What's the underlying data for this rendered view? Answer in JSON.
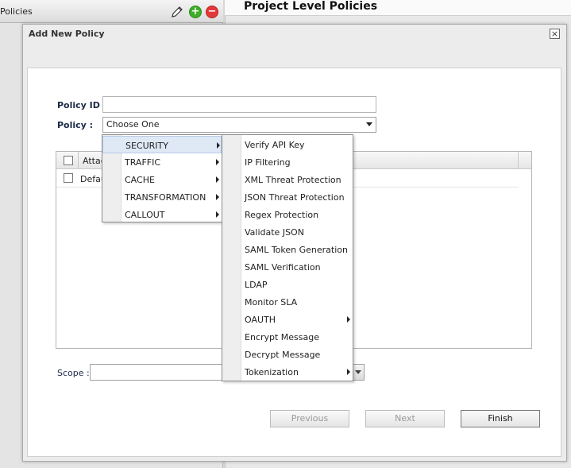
{
  "background": {
    "left_panel_title": "Policies",
    "right_panel_title": "Project Level Policies"
  },
  "dialog": {
    "title": "Add New Policy",
    "close_glyph": "×",
    "policy_id_label": "Policy ID :",
    "policy_id_value": "",
    "policy_label": "Policy :",
    "policy_selected": "Choose One",
    "grid_header": "Attac",
    "grid_rows": [
      "Defau"
    ],
    "scope_label": "Scope :",
    "scope_value": "",
    "buttons": {
      "previous": "Previous",
      "next": "Next",
      "finish": "Finish"
    }
  },
  "category_menu": [
    {
      "label": "SECURITY",
      "has_submenu": true,
      "active": true
    },
    {
      "label": "TRAFFIC",
      "has_submenu": true
    },
    {
      "label": "CACHE",
      "has_submenu": true
    },
    {
      "label": "TRANSFORMATION",
      "has_submenu": true
    },
    {
      "label": "CALLOUT",
      "has_submenu": true
    }
  ],
  "security_submenu": [
    {
      "label": "Verify API Key"
    },
    {
      "label": "IP Filtering"
    },
    {
      "label": "XML Threat Protection"
    },
    {
      "label": "JSON Threat Protection"
    },
    {
      "label": "Regex Protection"
    },
    {
      "label": "Validate JSON"
    },
    {
      "label": "SAML Token Generation"
    },
    {
      "label": "SAML Verification"
    },
    {
      "label": "LDAP"
    },
    {
      "label": "Monitor SLA"
    },
    {
      "label": "OAUTH",
      "has_submenu": true
    },
    {
      "label": "Encrypt Message"
    },
    {
      "label": "Decrypt Message"
    },
    {
      "label": "Tokenization",
      "has_submenu": true
    }
  ],
  "icons": [
    "pencil-icon",
    "add-icon",
    "remove-icon",
    "close-icon",
    "chevron-down-icon",
    "chevron-right-icon"
  ],
  "colors": {
    "add_icon": "#3fae2a",
    "remove_icon": "#e23a3a",
    "active_menu_bg": "#dfe9f6"
  }
}
